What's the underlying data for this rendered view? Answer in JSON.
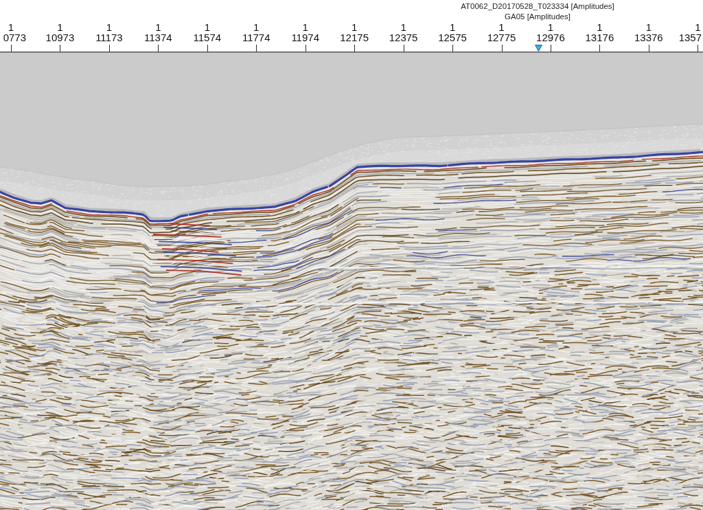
{
  "header": {
    "title_lines": [
      "AT0062_D20170528_T023334 [Amplitudes]",
      "GA05 [Amplitudes]"
    ]
  },
  "axis": {
    "ticks": [
      {
        "upper_label": "1",
        "lower_label": "0773"
      },
      {
        "upper_label": "1",
        "lower_label": "10973"
      },
      {
        "upper_label": "1",
        "lower_label": "11173"
      },
      {
        "upper_label": "1",
        "lower_label": "11374"
      },
      {
        "upper_label": "1",
        "lower_label": "11574"
      },
      {
        "upper_label": "1",
        "lower_label": "11774"
      },
      {
        "upper_label": "1",
        "lower_label": "11974"
      },
      {
        "upper_label": "1",
        "lower_label": "12175"
      },
      {
        "upper_label": "1",
        "lower_label": "12375"
      },
      {
        "upper_label": "1",
        "lower_label": "12575"
      },
      {
        "upper_label": "1",
        "lower_label": "12775"
      },
      {
        "upper_label": "1",
        "lower_label": "12976"
      },
      {
        "upper_label": "1",
        "lower_label": "13176"
      },
      {
        "upper_label": "1",
        "lower_label": "13376"
      },
      {
        "upper_label": "1",
        "lower_label": "1357"
      }
    ]
  }
}
